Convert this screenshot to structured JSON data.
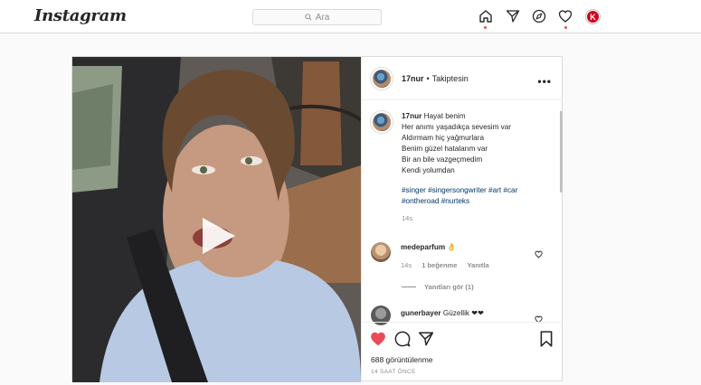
{
  "app": {
    "logo": "Instagram"
  },
  "search": {
    "placeholder": "Ara"
  },
  "nav": {
    "items": [
      "home-icon",
      "direct-icon",
      "explore-icon",
      "activity-icon",
      "profile-avatar"
    ],
    "profile_initial": "K"
  },
  "post": {
    "username": "17nur",
    "separator": "•",
    "follow_status": "Takiptesin",
    "caption": {
      "username": "17nur",
      "first_line": "Hayat benim",
      "lines": [
        "Her anımı yaşadıkça sevesim var",
        "Aldırmam hiç yağmurlara",
        "Benim güzel hatalarım var",
        "Bir an bile vazgeçmedim",
        "Kendi yolumdan"
      ],
      "hashtags_line1": "#singer #singersongwriter #art #car",
      "hashtags_line2": "#ontheroad #nurteks",
      "time": "14s"
    },
    "comments": [
      {
        "username": "medeparfum",
        "text": "👌",
        "time": "14s",
        "likes": "1 beğenme",
        "reply": "Yanıtla",
        "view_replies": "Yanıtları gör (1)"
      },
      {
        "username": "gunerbayer",
        "text": "Güzellik ❤❤"
      }
    ],
    "views": "688 görüntülenme",
    "posted_ago": "14 SAAT ÖNCE"
  },
  "colors": {
    "like_red": "#ed4956",
    "link_blue": "#00376b",
    "border": "#dbdbdb"
  }
}
